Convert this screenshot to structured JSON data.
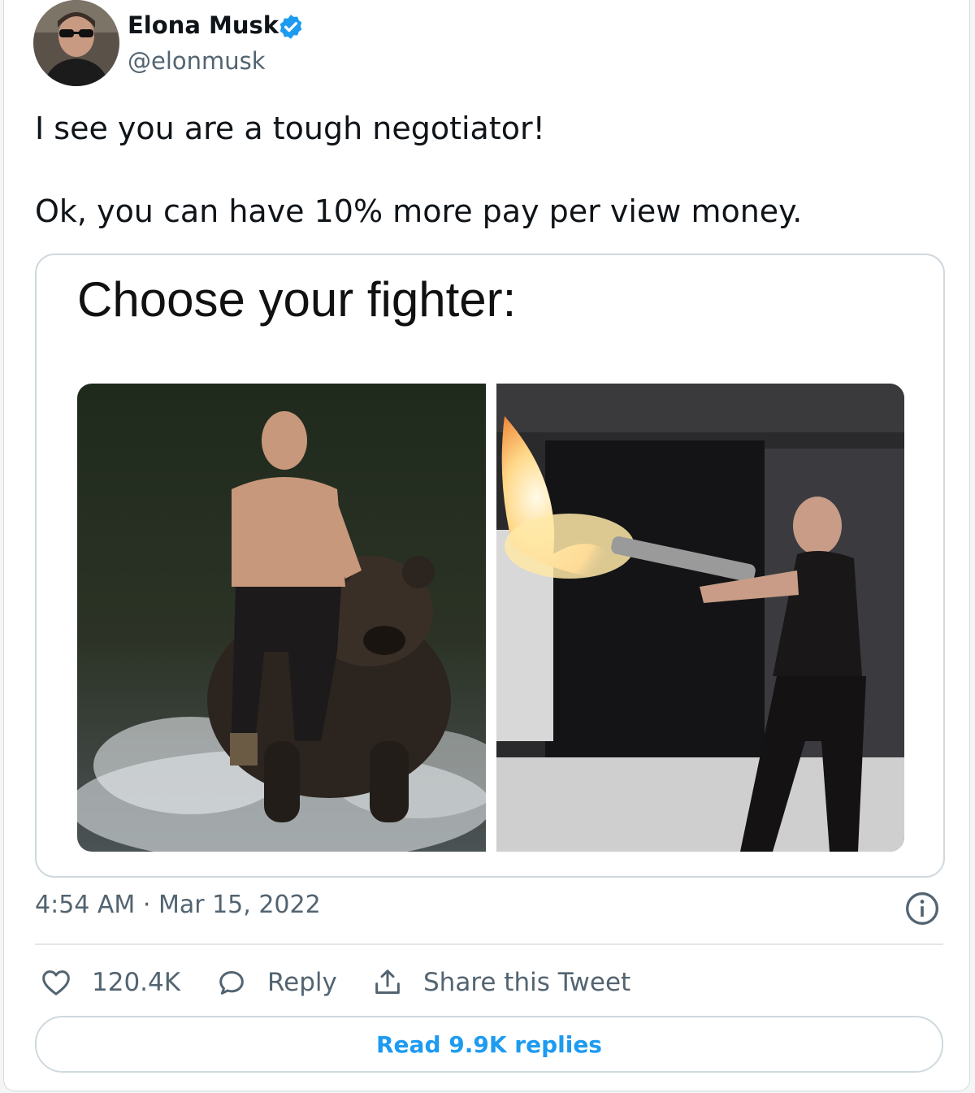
{
  "tweet": {
    "author_name": "Elona Musk",
    "author_handle": "@elonmusk",
    "verified": true,
    "text_line_1": "I see you are a tough negotiator!",
    "text_line_2": "Ok, you can have 10% more pay per view money.",
    "media": {
      "caption": "Choose your fighter:",
      "photos": [
        {
          "subject": "shirtless man riding a bear through water"
        },
        {
          "subject": "man firing a flamethrower indoors"
        }
      ]
    },
    "time": "4:54 AM",
    "separator": "·",
    "date": "Mar 15, 2022",
    "actions": {
      "like_count": "120.4K",
      "reply_label": "Reply",
      "share_label": "Share this Tweet"
    },
    "read_replies_label": "Read 9.9K replies"
  },
  "colors": {
    "accent": "#1d9bf0",
    "text_primary": "#0f1419",
    "text_secondary": "#536471",
    "border": "#cfd9de"
  },
  "icons": {
    "verified": "verified-badge-icon",
    "info": "info-icon",
    "like": "heart-icon",
    "reply": "speech-bubble-icon",
    "share": "share-upload-icon"
  }
}
